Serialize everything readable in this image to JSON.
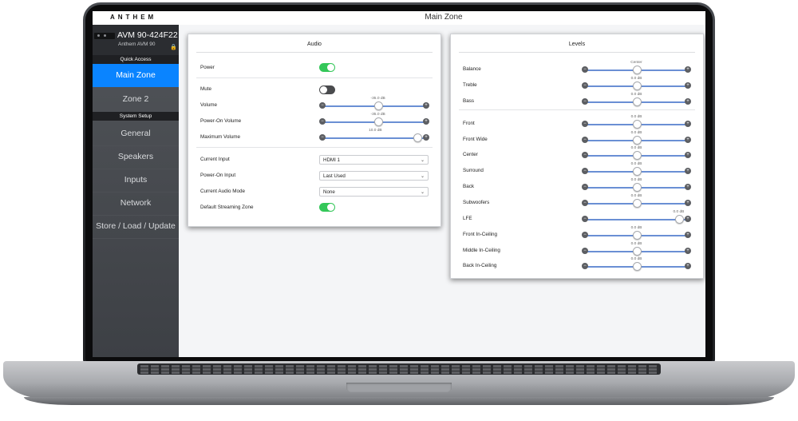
{
  "app": {
    "brand": "ANTHEM",
    "page_title": "Main Zone"
  },
  "sidebar": {
    "device_name": "AVM 90-424F22",
    "device_model": "Anthem AVM 90",
    "quick_access_header": "Quick Access",
    "system_setup_header": "System Setup",
    "items": [
      {
        "label": "Main Zone",
        "active": true
      },
      {
        "label": "Zone 2"
      },
      {
        "label": "General"
      },
      {
        "label": "Speakers"
      },
      {
        "label": "Inputs"
      },
      {
        "label": "Network"
      },
      {
        "label": "Store / Load / Update"
      }
    ]
  },
  "audio": {
    "title": "Audio",
    "power": {
      "label": "Power",
      "state": "on"
    },
    "mute": {
      "label": "Mute",
      "state": "off"
    },
    "volume": {
      "label": "Volume",
      "value": "-35.0 dB",
      "level": 0.54
    },
    "power_on_volume": {
      "label": "Power-On Volume",
      "value": "-35.0 dB",
      "level": 0.54
    },
    "maximum_volume": {
      "label": "Maximum Volume",
      "value": "10.0 dB",
      "level": 0.96
    },
    "current_input": {
      "label": "Current Input",
      "value": "HDMI 1"
    },
    "power_on_input": {
      "label": "Power-On Input",
      "value": "Last Used"
    },
    "current_audio_mode": {
      "label": "Current Audio Mode",
      "value": "None"
    },
    "default_streaming_zone": {
      "label": "Default Streaming Zone",
      "state": "on"
    }
  },
  "levels": {
    "title": "Levels",
    "channels": [
      {
        "label": "Balance",
        "value": "Center",
        "level": 0.5
      },
      {
        "label": "Treble",
        "value": "0.0 dB",
        "level": 0.5
      },
      {
        "label": "Bass",
        "value": "0.0 dB",
        "level": 0.5
      },
      {
        "label": "Front",
        "value": "0.0 dB",
        "level": 0.5
      },
      {
        "label": "Front Wide",
        "value": "0.0 dB",
        "level": 0.5
      },
      {
        "label": "Center",
        "value": "0.0 dB",
        "level": 0.5
      },
      {
        "label": "Surround",
        "value": "0.0 dB",
        "level": 0.5
      },
      {
        "label": "Back",
        "value": "0.0 dB",
        "level": 0.5
      },
      {
        "label": "Subwoofers",
        "value": "0.0 dB",
        "level": 0.5
      },
      {
        "label": "LFE",
        "value": "0.0 dB",
        "level": 0.96
      },
      {
        "label": "Front In-Ceiling",
        "value": "0.0 dB",
        "level": 0.5
      },
      {
        "label": "Middle In-Ceiling",
        "value": "0.0 dB",
        "level": 0.5
      },
      {
        "label": "Back In-Ceiling",
        "value": "0.0 dB",
        "level": 0.5
      }
    ]
  },
  "icons": {
    "minus": "−",
    "plus": "+",
    "chevron": "⌄",
    "lock": "🔒"
  },
  "colors": {
    "accent": "#0a84ff",
    "toggle_on": "#34c759",
    "slider_track": "#6a8fd4"
  }
}
